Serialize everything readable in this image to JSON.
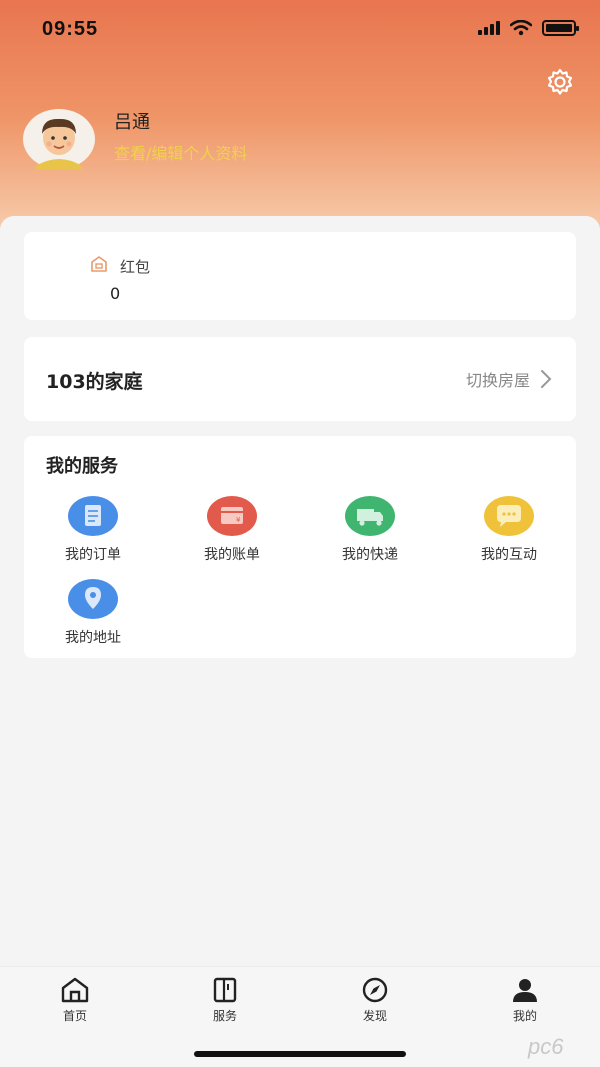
{
  "status_bar": {
    "time": "09:55"
  },
  "profile": {
    "name": "吕通",
    "edit_link": "查看/编辑个人资料"
  },
  "wallet": {
    "label": "红包",
    "value": "0"
  },
  "home": {
    "title": "103的家庭",
    "switch_label": "切换房屋"
  },
  "services": {
    "title": "我的服务",
    "items": [
      {
        "label": "我的订单",
        "icon": "order-icon",
        "color": "#4a8fe7"
      },
      {
        "label": "我的账单",
        "icon": "bill-icon",
        "color": "#e15a4c"
      },
      {
        "label": "我的快递",
        "icon": "delivery-icon",
        "color": "#3fb56f"
      },
      {
        "label": "我的互动",
        "icon": "chat-icon",
        "color": "#f0c23a"
      },
      {
        "label": "我的地址",
        "icon": "address-icon",
        "color": "#4a8fe7"
      }
    ]
  },
  "tabbar": {
    "items": [
      {
        "label": "首页",
        "icon": "home-icon"
      },
      {
        "label": "服务",
        "icon": "service-icon"
      },
      {
        "label": "发现",
        "icon": "compass-icon"
      },
      {
        "label": "我的",
        "icon": "user-icon"
      }
    ]
  },
  "watermark": "pc6",
  "colors": {
    "header_top": "#e8754f",
    "accent_link": "#f0d24a"
  }
}
